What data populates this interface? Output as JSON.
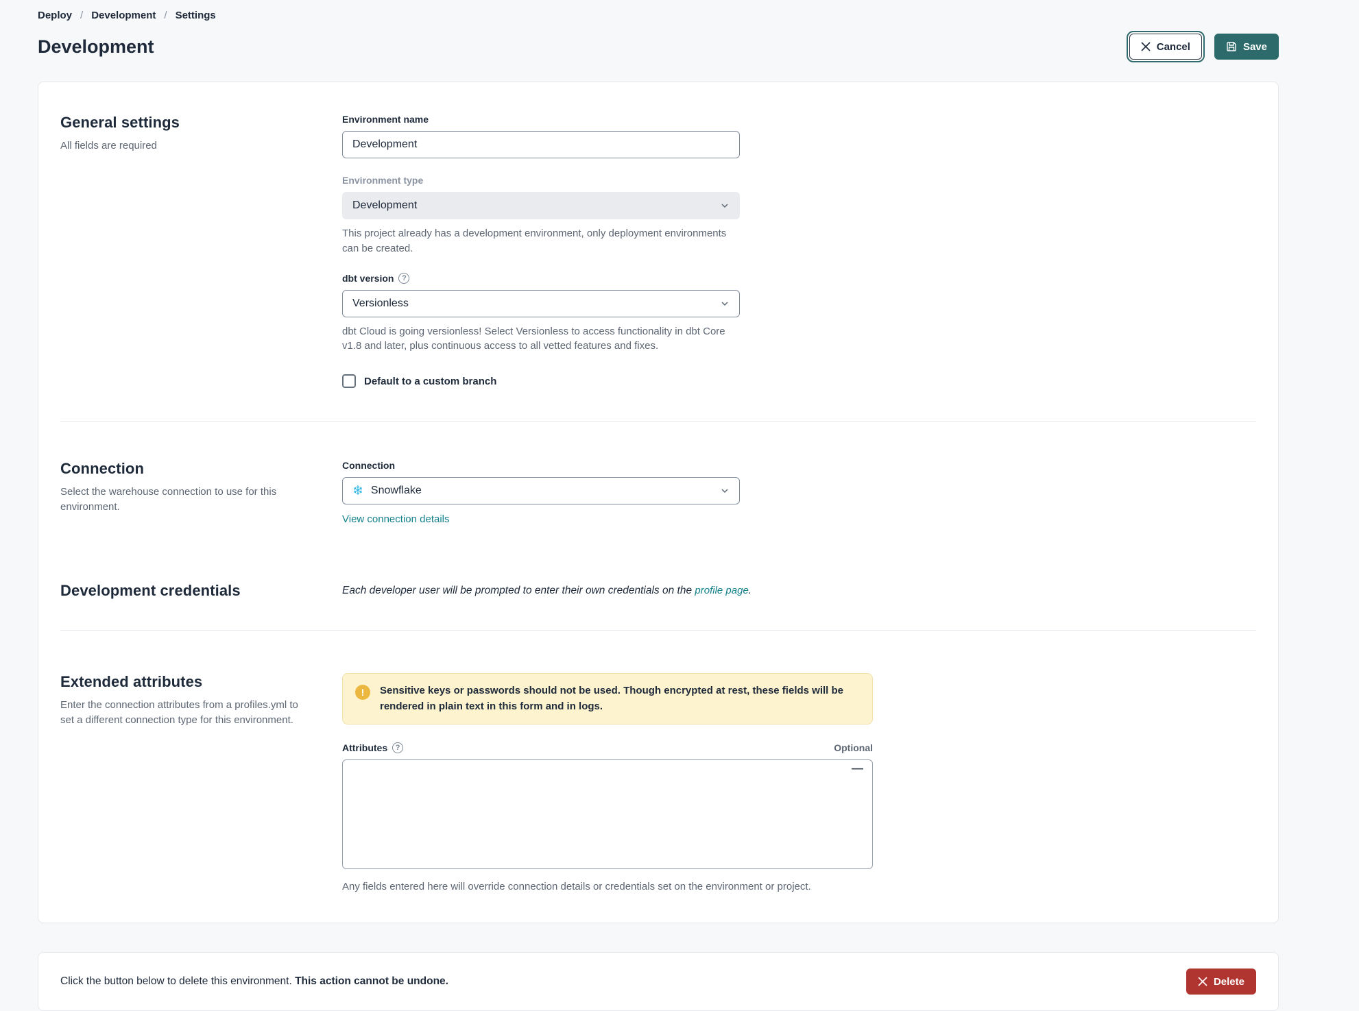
{
  "breadcrumb": {
    "items": [
      "Deploy",
      "Development",
      "Settings"
    ],
    "separator": "/"
  },
  "header": {
    "title": "Development",
    "cancel_label": "Cancel",
    "save_label": "Save"
  },
  "general": {
    "heading": "General settings",
    "subheading": "All fields are required",
    "env_name_label": "Environment name",
    "env_name_value": "Development",
    "env_type_label": "Environment type",
    "env_type_value": "Development",
    "env_type_help": "This project already has a development environment, only deployment environments can be created.",
    "dbt_version_label": "dbt version",
    "dbt_version_value": "Versionless",
    "dbt_version_help": "dbt Cloud is going versionless! Select Versionless to access functionality in dbt Core v1.8 and later, plus continuous access to all vetted features and fixes.",
    "custom_branch_label": "Default to a custom branch"
  },
  "connection": {
    "heading": "Connection",
    "subheading": "Select the warehouse connection to use for this environment.",
    "field_label": "Connection",
    "value": "Snowflake",
    "snowflake_icon_glyph": "❄",
    "link": "View connection details"
  },
  "credentials": {
    "heading": "Development credentials",
    "note_prefix": "Each developer user will be prompted to enter their own credentials on the ",
    "note_link": "profile page",
    "note_suffix": "."
  },
  "extended": {
    "heading": "Extended attributes",
    "subheading": "Enter the connection attributes from a profiles.yml to set a different connection type for this environment.",
    "warning_icon_glyph": "!",
    "warning": "Sensitive keys or passwords should not be used. Though encrypted at rest, these fields will be rendered in plain text in this form and in logs.",
    "attributes_label": "Attributes",
    "optional_label": "Optional",
    "attributes_value": "",
    "fold_glyph": "—",
    "help": "Any fields entered here will override connection details or credentials set on the environment or project.",
    "help_icon_glyph": "?"
  },
  "danger": {
    "text_prefix": "Click the button below to delete this environment. ",
    "text_bold": "This action cannot be undone.",
    "delete_label": "Delete"
  },
  "colors": {
    "accent_teal": "#2d6a6b",
    "link_teal": "#13808a",
    "danger_red": "#b03530",
    "warning_bg": "#fdf3cf",
    "warning_icon": "#ecb73e",
    "snowflake_blue": "#29b5e8",
    "page_bg": "#f7f8fa",
    "card_border": "#e4e7ec"
  }
}
